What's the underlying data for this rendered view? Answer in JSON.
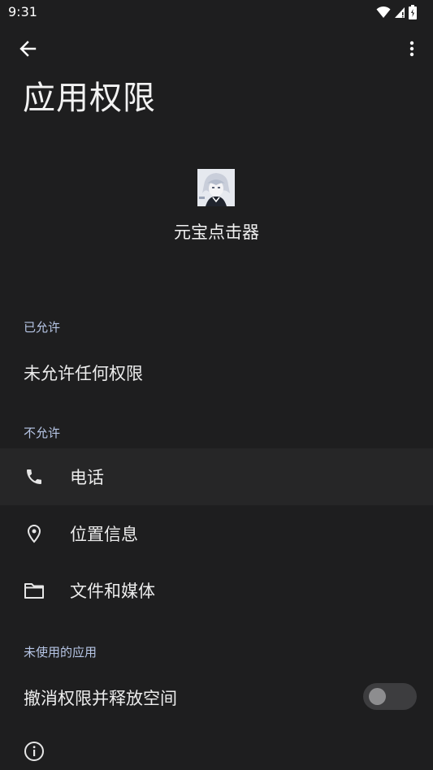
{
  "status_bar": {
    "time": "9:31",
    "icons": [
      "wifi-icon",
      "signal-icon",
      "battery-icon"
    ]
  },
  "app_bar": {
    "back_icon": "arrow-back-icon",
    "menu_icon": "more-vert-icon"
  },
  "page": {
    "title": "应用权限"
  },
  "app": {
    "name": "元宝点击器",
    "icon": "app-avatar-icon"
  },
  "sections": {
    "allowed": {
      "header": "已允许",
      "empty_text": "未允许任何权限"
    },
    "not_allowed": {
      "header": "不允许",
      "items": [
        {
          "label": "电话",
          "icon": "phone-icon"
        },
        {
          "label": "位置信息",
          "icon": "location-pin-icon"
        },
        {
          "label": "文件和媒体",
          "icon": "folder-icon"
        }
      ]
    },
    "unused_apps": {
      "header": "未使用的应用",
      "toggle_label": "撤消权限并释放空间",
      "toggle_on": false
    }
  },
  "footer": {
    "icon": "info-icon"
  },
  "colors": {
    "background": "#1e1e1f",
    "section_header": "#b7c6e6",
    "highlight_row": "#262627",
    "toggle_track": "#3d3d3f",
    "toggle_thumb": "#8d8d8f"
  }
}
